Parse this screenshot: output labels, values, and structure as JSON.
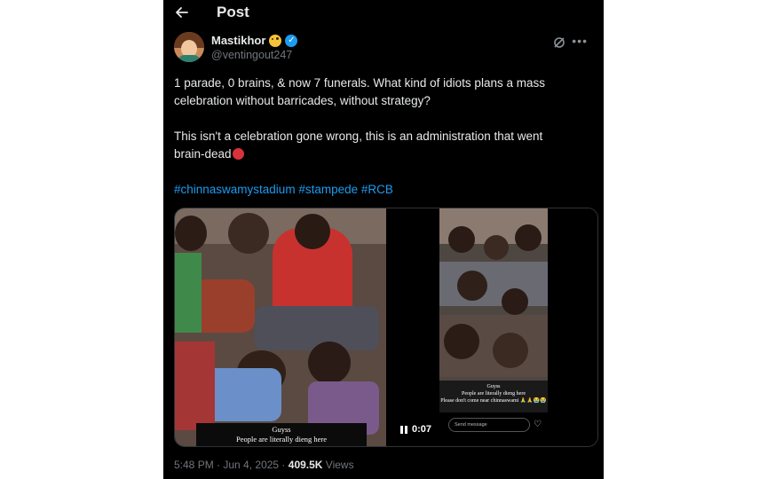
{
  "header": {
    "title": "Post",
    "back_icon": "arrow-left-icon"
  },
  "author": {
    "name": "Mastikhor",
    "handle": "@ventingout247",
    "name_emoji": "laughing-face-emoji",
    "verified_icon": "verified-badge-icon",
    "actions": [
      "grok-icon",
      "more-icon"
    ]
  },
  "tweet": {
    "line1": "1 parade, 0 brains, & now 7 funerals. What kind of idiots plans a mass",
    "line2": "celebration without barricades, without strategy?",
    "line3": "This isn't a celebration gone wrong, this is an administration that went",
    "line4": "brain-dead",
    "emoji": "angry-face-emoji",
    "hashtags": [
      "#chinnaswamystadium",
      "#stampede",
      "#RCB"
    ]
  },
  "media": {
    "left_caption_line1": "Guyss",
    "left_caption_line2": "People are literally dieng here",
    "right_caption_line1": "Guyss",
    "right_caption_line2": "People are literally dieng here",
    "right_caption_line3": "Please don't come near chinnaswami 🙏🙏😭😭",
    "message_placeholder": "Send message",
    "video_time": "0:07"
  },
  "meta": {
    "time": "5:48 PM",
    "separator1": " · ",
    "date": "Jun 4, 2025",
    "separator2": " · ",
    "views_count": "409.5K",
    "views_label": " Views"
  },
  "colors": {
    "background": "#000000",
    "text": "#e7e9ea",
    "secondary_text": "#71767b",
    "link": "#1d9bf0",
    "verified": "#1d9bf0"
  }
}
